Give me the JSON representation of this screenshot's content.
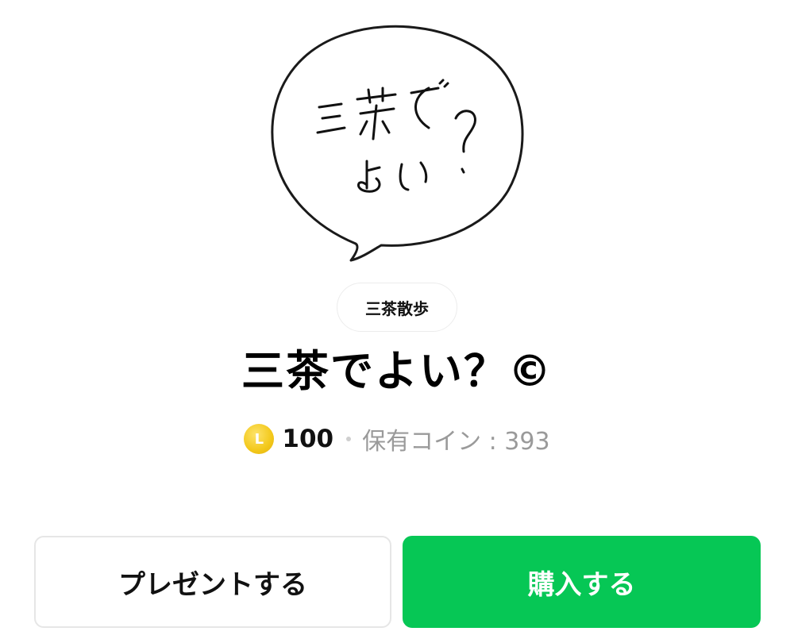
{
  "sticker": {
    "handwritten_text_line1": "三茶で",
    "handwritten_text_line2": "よい？"
  },
  "author": {
    "name": "三茶散歩"
  },
  "product": {
    "title": "三茶でよい？©"
  },
  "price": {
    "coin_symbol": "L",
    "amount": "100",
    "owned_coins": "保有コイン : 393",
    "coin_color": "#f3c81a"
  },
  "actions": {
    "present_label": "プレゼントする",
    "buy_label": "購入する",
    "buy_color": "#06c755"
  }
}
